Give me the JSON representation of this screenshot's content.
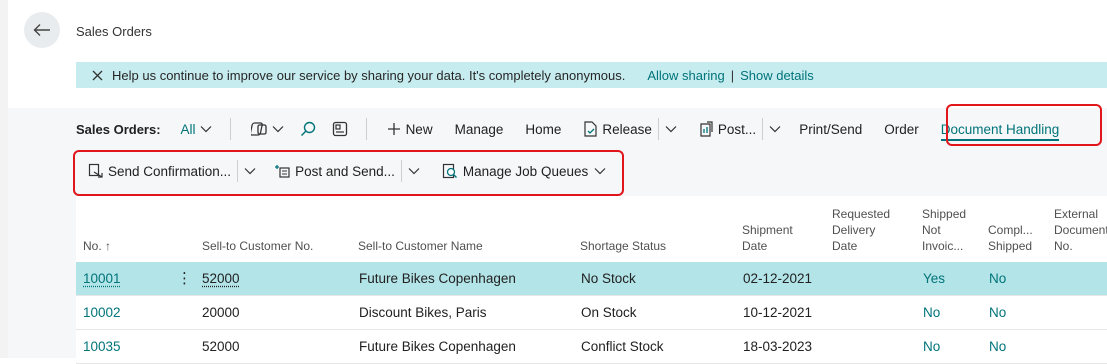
{
  "page": {
    "title": "Sales Orders"
  },
  "banner": {
    "message": "Help us continue to improve our service by sharing your data. It's completely anonymous.",
    "allow_label": "Allow sharing",
    "separator": "|",
    "details_label": "Show details",
    "bg_color": "#c7ecef"
  },
  "actionbar": {
    "page_label": "Sales Orders:",
    "filter_label": "All",
    "new_label": "New",
    "manage_label": "Manage",
    "home_label": "Home",
    "release_label": "Release",
    "post_label": "Post...",
    "print_send_label": "Print/Send",
    "order_label": "Order",
    "document_handling_label": "Document Handling"
  },
  "subbar": {
    "send_confirmation_label": "Send Confirmation...",
    "post_and_send_label": "Post and Send...",
    "manage_job_queues_label": "Manage Job Queues"
  },
  "table": {
    "headers": {
      "no": "No. ↑",
      "sell_to_no": "Sell-to Customer No.",
      "sell_to_name": "Sell-to Customer Name",
      "shortage": "Shortage Status",
      "shipment_date": [
        "Shipment",
        "Date"
      ],
      "requested_delivery": [
        "Requested",
        "Delivery",
        "Date"
      ],
      "shipped_not_invoiced": [
        "Shipped",
        "Not",
        "Invoic..."
      ],
      "completely_shipped": [
        "Compl...",
        "Shipped"
      ],
      "external_doc": [
        "External",
        "Document",
        "No."
      ]
    },
    "rows": [
      {
        "no": "10001",
        "cust_no": "52000",
        "cust_name": "Future Bikes Copenhagen",
        "shortage": "No Stock",
        "shipment_date": "02-12-2021",
        "requested": "",
        "shipped_not_invoiced": "Yes",
        "completely_shipped": "No",
        "external": ""
      },
      {
        "no": "10002",
        "cust_no": "20000",
        "cust_name": "Discount Bikes, Paris",
        "shortage": "On Stock",
        "shipment_date": "10-12-2021",
        "requested": "",
        "shipped_not_invoiced": "No",
        "completely_shipped": "No",
        "external": ""
      },
      {
        "no": "10035",
        "cust_no": "52000",
        "cust_name": "Future Bikes Copenhagen",
        "shortage": "Conflict Stock",
        "shipment_date": "18-03-2023",
        "requested": "",
        "shipped_not_invoiced": "No",
        "completely_shipped": "No",
        "external": ""
      }
    ]
  },
  "colors": {
    "accent": "#00747a",
    "selected_row": "#b3e4e8",
    "highlight": "#e0161c"
  },
  "icons": [
    "back-arrow-icon",
    "close-icon",
    "filter-icon",
    "search-icon",
    "share-icon",
    "plus-icon",
    "release-icon",
    "post-icon",
    "send-confirmation-icon",
    "post-and-send-icon",
    "job-queue-icon",
    "chevron-down-icon",
    "sort-ascending-icon",
    "row-menu-icon"
  ]
}
